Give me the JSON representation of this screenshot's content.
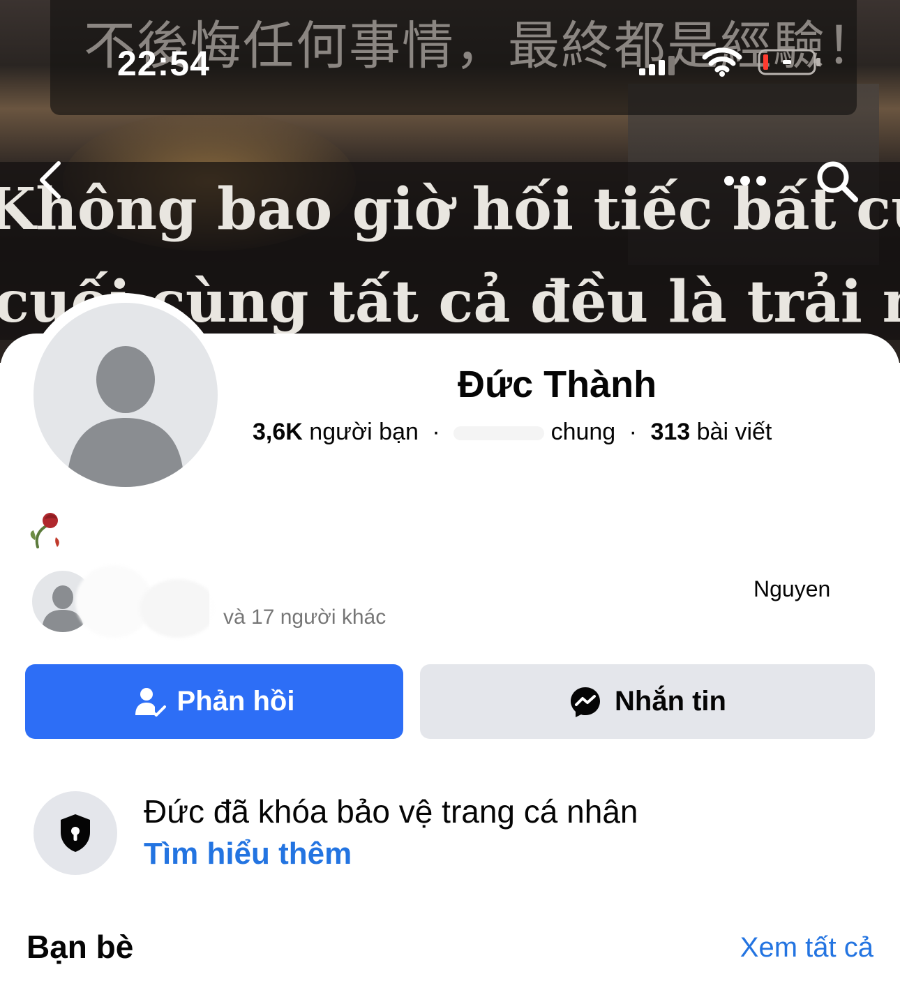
{
  "status_bar": {
    "time": "22:54"
  },
  "cover": {
    "text_cn": "不後悔任何事情，最終都是經驗！",
    "text_vi_line1": "Không bao giờ hối tiếc bất cứ điều gì",
    "text_vi_line2": "cuối cùng tất cả đều là trải nghiệm"
  },
  "nav": {
    "back_icon": "chevron-left-icon",
    "more_icon": "more-icon",
    "search_icon": "search-icon"
  },
  "profile": {
    "name": "Đức Thành",
    "friends_count": "3,6K",
    "friends_label": "người bạn",
    "mutual_label": "chung",
    "posts_count": "313",
    "posts_label": "bài viết",
    "bio_emoji": "🥀"
  },
  "mutual": {
    "line1": "Nguyen",
    "line2": "và 17 người khác"
  },
  "actions": {
    "reply_label": "Phản hồi",
    "message_label": "Nhắn tin"
  },
  "privacy": {
    "title": "Đức đã khóa bảo vệ trang cá nhân",
    "link": "Tìm hiểu thêm"
  },
  "friends_section": {
    "title": "Bạn bè",
    "see_all": "Xem tất cả"
  },
  "colors": {
    "primary": "#2d6ef6",
    "link": "#2374e1",
    "secondary_bg": "#e4e6eb"
  }
}
